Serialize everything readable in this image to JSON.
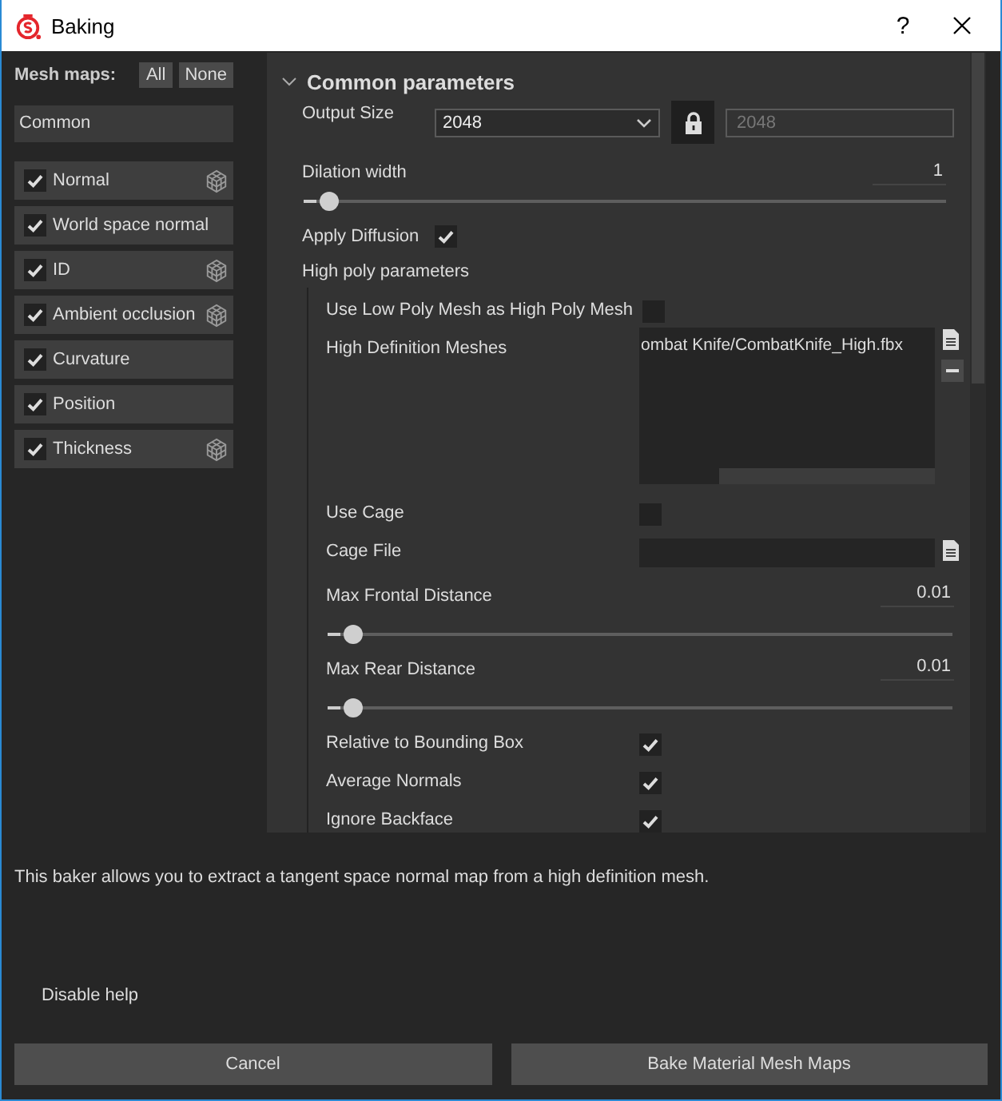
{
  "window": {
    "title": "Baking",
    "help_button": "?"
  },
  "mesh_maps": {
    "label": "Mesh maps:",
    "buttons": [
      "All",
      "None"
    ],
    "group": "Common",
    "items": [
      {
        "label": "Normal",
        "checked": true,
        "cube_icon": true
      },
      {
        "label": "World space normal",
        "checked": true,
        "cube_icon": false
      },
      {
        "label": "ID",
        "checked": true,
        "cube_icon": true
      },
      {
        "label": "Ambient occlusion",
        "checked": true,
        "cube_icon": true
      },
      {
        "label": "Curvature",
        "checked": true,
        "cube_icon": false
      },
      {
        "label": "Position",
        "checked": true,
        "cube_icon": false
      },
      {
        "label": "Thickness",
        "checked": true,
        "cube_icon": true
      }
    ]
  },
  "common_parameters": {
    "title": "Common parameters",
    "expanded": true,
    "output_size": {
      "label": "Output Size",
      "value": "2048",
      "linked_value": "2048"
    },
    "dilation_width": {
      "label": "Dilation width",
      "value": "1",
      "level": 0.02
    },
    "apply_diffusion": {
      "label": "Apply Diffusion",
      "checked": true
    },
    "high_poly": {
      "label": "High poly parameters",
      "rows": [
        {
          "kind": "checkbox",
          "label": "Use Low Poly Mesh as High Poly Mesh",
          "checked": false
        },
        {
          "kind": "filelist",
          "label": "High Definition Meshes",
          "files": [
            "ombat Knife/CombatKnife_High.fbx"
          ]
        },
        {
          "kind": "checkbox",
          "label": "Use Cage",
          "checked": false
        },
        {
          "kind": "file",
          "label": "Cage File"
        },
        {
          "kind": "slider",
          "label": "Max Frontal Distance",
          "value": "0.01",
          "level": 0.02
        },
        {
          "kind": "slider",
          "label": "Max Rear Distance",
          "value": "0.01",
          "level": 0.02
        },
        {
          "kind": "checkbox",
          "label": "Relative to Bounding Box",
          "checked": true
        },
        {
          "kind": "checkbox",
          "label": "Average Normals",
          "checked": true
        },
        {
          "kind": "checkbox",
          "label": "Ignore Backface",
          "checked": true
        }
      ]
    }
  },
  "help_text": "This baker allows you to extract a tangent space normal map from a high definition mesh.",
  "disable_help": "Disable help",
  "buttons": [
    "Cancel",
    "Bake Material Mesh Maps"
  ]
}
